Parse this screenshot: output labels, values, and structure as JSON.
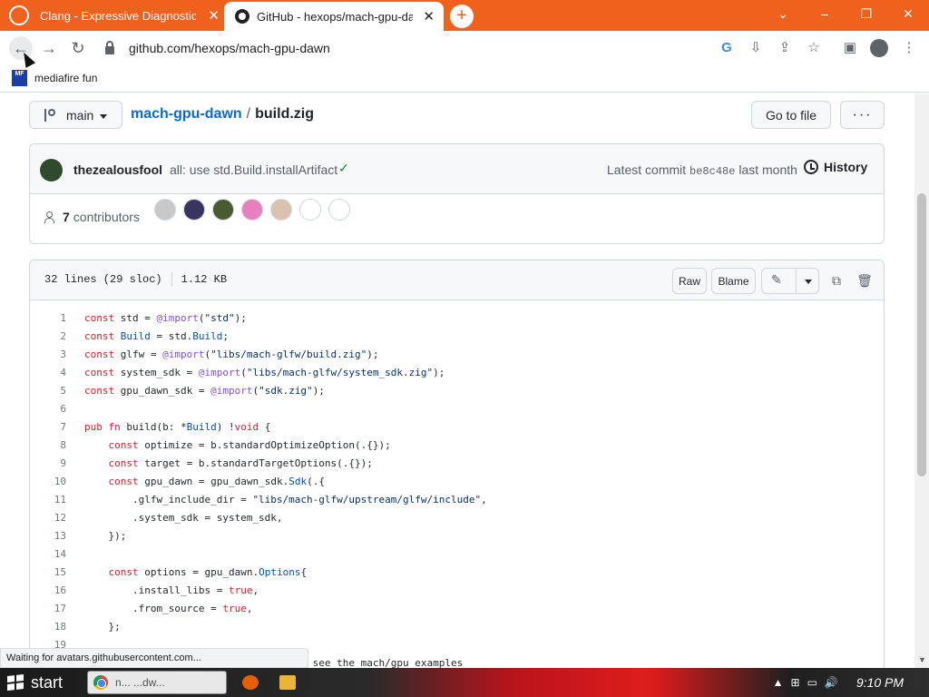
{
  "browser": {
    "tabs": [
      {
        "title": "Clang - Expressive Diagnostics",
        "close": "✕"
      },
      {
        "title": "GitHub - hexops/mach-gpu-dawn",
        "close": "✕"
      }
    ],
    "new_tab": "+",
    "window_controls": {
      "chevron": "⌄",
      "minimize": "–",
      "restore": "❐",
      "close": "✕"
    },
    "url": "github.com/hexops/mach-gpu-dawn",
    "bookmark": {
      "icon_text": "MF",
      "label": "mediafire fun"
    }
  },
  "repo": {
    "branch": "main",
    "repo_name": "mach-gpu-dawn",
    "separator": "/",
    "file_name": "build.zig",
    "goto_label": "Go to file",
    "more_label": "···"
  },
  "commit": {
    "author": "thezealousfool",
    "message": "all: use std.Build.installArtifact",
    "latest_label": "Latest commit",
    "sha": "be8c48e",
    "when": "last month",
    "history_label": "History",
    "contributors_count": "7",
    "contributors_label": "contributors",
    "contributor_colors": [
      "#c8c8c8",
      "#3a3560",
      "#4a5a30",
      "#e87fbf",
      "#d9c3b0",
      "#ffffff",
      "#ffffff"
    ]
  },
  "file": {
    "lines_info": "32 lines (29 sloc)",
    "size": "1.12 KB",
    "raw_label": "Raw",
    "blame_label": "Blame",
    "lines": [
      {
        "n": "1",
        "t": "const std = @import(\"std\");"
      },
      {
        "n": "2",
        "t": "const Build = std.Build;"
      },
      {
        "n": "3",
        "t": "const glfw = @import(\"libs/mach-glfw/build.zig\");"
      },
      {
        "n": "4",
        "t": "const system_sdk = @import(\"libs/mach-glfw/system_sdk.zig\");"
      },
      {
        "n": "5",
        "t": "const gpu_dawn_sdk = @import(\"sdk.zig\");"
      },
      {
        "n": "6",
        "t": ""
      },
      {
        "n": "7",
        "t": "pub fn build(b: *Build) !void {"
      },
      {
        "n": "8",
        "t": "    const optimize = b.standardOptimizeOption(.{});"
      },
      {
        "n": "9",
        "t": "    const target = b.standardTargetOptions(.{});"
      },
      {
        "n": "10",
        "t": "    const gpu_dawn = gpu_dawn_sdk.Sdk(.{"
      },
      {
        "n": "11",
        "t": "        .glfw_include_dir = \"libs/mach-glfw/upstream/glfw/include\","
      },
      {
        "n": "12",
        "t": "        .system_sdk = system_sdk,"
      },
      {
        "n": "13",
        "t": "    });"
      },
      {
        "n": "14",
        "t": ""
      },
      {
        "n": "15",
        "t": "    const options = gpu_dawn.Options{"
      },
      {
        "n": "16",
        "t": "        .install_libs = true,"
      },
      {
        "n": "17",
        "t": "        .from_source = true,"
      },
      {
        "n": "18",
        "t": "    };"
      },
      {
        "n": "19",
        "t": ""
      },
      {
        "n": "20",
        "t": "ng. This is not a functional example, see the mach/gpu examples"
      }
    ]
  },
  "status_text": "Waiting for avatars.githubusercontent.com...",
  "taskbar": {
    "start_label": "start",
    "task_label": "n... ...dw...",
    "clock": "9:10 PM"
  }
}
